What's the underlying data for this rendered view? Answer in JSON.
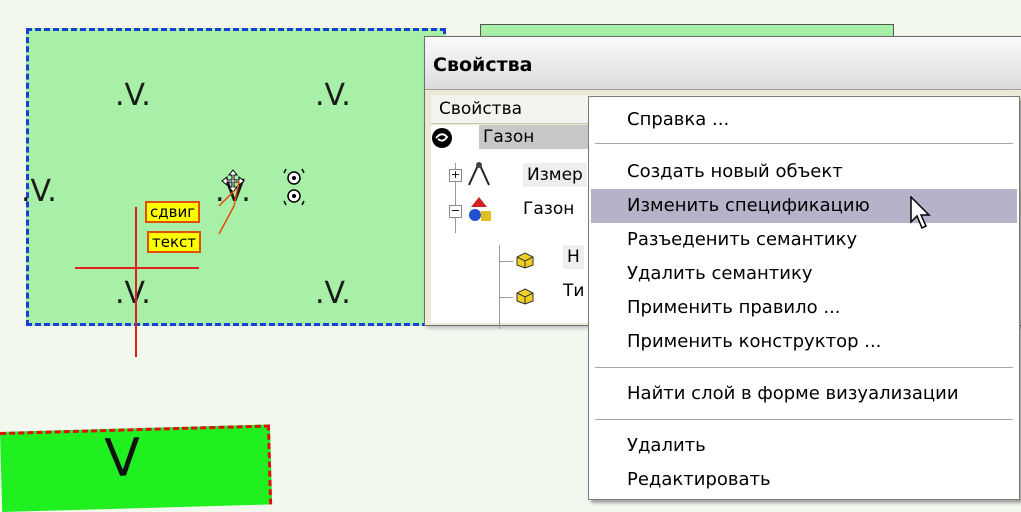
{
  "map": {
    "labels": {
      "shift": "сдвиг",
      "text": "текст"
    },
    "grass_symbol": ".V."
  },
  "properties_window": {
    "title": "Свойства",
    "header": "Свойства",
    "tree": [
      {
        "label": "Газон",
        "selected": true
      },
      {
        "label": "Измер"
      },
      {
        "label": "Газон"
      },
      {
        "label": "Н"
      },
      {
        "label": "Ти"
      }
    ]
  },
  "context_menu": {
    "groups": [
      [
        "Справка ..."
      ],
      [
        "Создать новый объект",
        "Изменить спецификацию",
        "Разъеденить семантику",
        "Удалить семантику",
        "Применить правило ...",
        "Применить конструктор ..."
      ],
      [
        "Найти слой в форме визуализации"
      ],
      [
        "Удалить",
        "Редактировать"
      ]
    ],
    "highlighted": "Изменить спецификацию"
  },
  "colors": {
    "lawn": "#a8f0a8",
    "selection_border": "#1a3fd6",
    "bright_lawn": "#20f020",
    "menu_highlight": "#b5b3c9"
  }
}
